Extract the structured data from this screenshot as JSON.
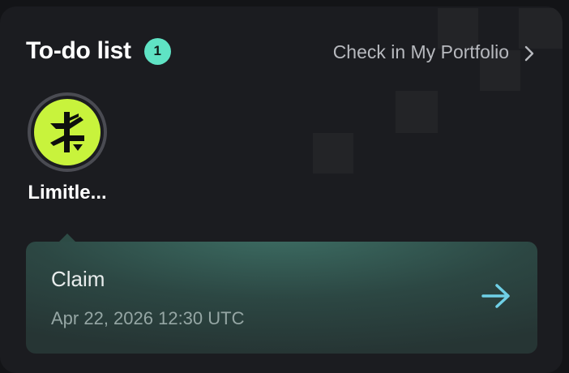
{
  "header": {
    "title": "To-do list",
    "badge_count": "1",
    "portfolio_link_label": "Check in My Portfolio",
    "portfolio_link_icon": "chevron-right-icon"
  },
  "token": {
    "name": "Limitle...",
    "logo_icon": "limitless-logo-icon",
    "logo_color": "#c8f33c"
  },
  "task": {
    "title": "Claim",
    "date": "Apr 22, 2026 12:30 UTC",
    "action_icon": "arrow-right-icon",
    "accent_color": "#6fd0e6"
  },
  "colors": {
    "badge": "#5fe3c4",
    "card_background": "#1b1c20"
  }
}
